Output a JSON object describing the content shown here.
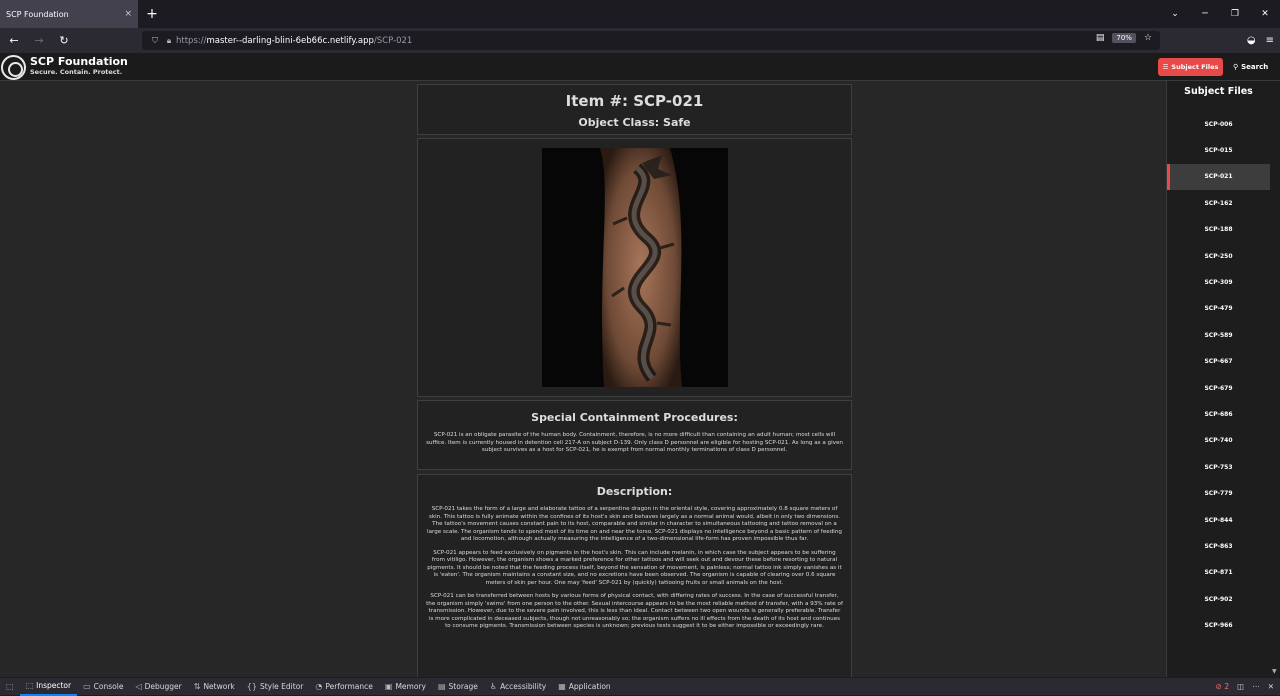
{
  "browser": {
    "tab_title": "SCP Foundation",
    "tab_close": "×",
    "new_tab": "+",
    "url_prefix": "https://",
    "url_host": "master--darling-blini-6eb66c.netlify.app",
    "url_path": "/SCP-021",
    "zoom": "70%",
    "window_controls": [
      "⌄",
      "─",
      "❐",
      "✕"
    ]
  },
  "site": {
    "logo_title": "SCP Foundation",
    "logo_subtitle": "Secure. Contain. Protect.",
    "subject_files_button": "Subject Files",
    "search_button": "Search"
  },
  "item": {
    "title": "Item #: SCP-021",
    "object_class": "Object Class: Safe",
    "containment_heading": "Special Containment Procedures:",
    "containment_text": "SCP-021 is an obligate parasite of the human body. Containment, therefore, is no more difficult than containing an adult human; most cells will suffice. Item is currently housed in detention cell 217-A on subject D-139. Only class D personnel are eligible for hosting SCP-021. As long as a given subject survives as a host for SCP-021, he is exempt from normal monthly terminations of class D personnel.",
    "description_heading": "Description:",
    "description_p1": "SCP-021 takes the form of a large and elaborate tattoo of a serpentine dragon in the oriental style, covering approximately 0.8 square meters of skin. This tattoo is fully animate within the confines of its host's skin and behaves largely as a normal animal would, albeit in only two dimensions. The tattoo's movement causes constant pain to its host, comparable and similar in character to simultaneous tattooing and tattoo removal on a large scale. The organism tends to spend most of its time on and near the torso. SCP-021 displays no intelligence beyond a basic pattern of feeding and locomotion, although actually measuring the intelligence of a two-dimensional life-form has proven impossible thus far.",
    "description_p2": "SCP-021 appears to feed exclusively on pigments in the host's skin. This can include melanin, in which case the subject appears to be suffering from vitiligo. However, the organism shows a marked preference for other tattoos and will seek out and devour these before resorting to natural pigments. It should be noted that the feeding process itself, beyond the sensation of movement, is painless; normal tattoo ink simply vanishes as it is 'eaten'. The organism maintains a constant size, and no excretions have been observed. The organism is capable of clearing over 0.6 square meters of skin per hour. One may 'feed' SCP-021 by (quickly) tattooing fruits or small animals on the host.",
    "description_p3": "SCP-021 can be transferred between hosts by various forms of physical contact, with differing rates of success. In the case of successful transfer, the organism simply 'swims' from one person to the other. Sexual intercourse appears to be the most reliable method of transfer, with a 93% rate of transmission. However, due to the severe pain involved, this is less than ideal. Contact between two open wounds is generally preferable. Transfer is more complicated in deceased subjects, though not unreasonably so; the organism suffers no ill effects from the death of its host and continues to consume pigments. Transmission between species is unknown; previous tests suggest it to be either impossible or exceedingly rare."
  },
  "sidebar": {
    "heading": "Subject Files",
    "items": [
      "SCP-006",
      "SCP-015",
      "SCP-021",
      "SCP-162",
      "SCP-188",
      "SCP-250",
      "SCP-309",
      "SCP-479",
      "SCP-589",
      "SCP-667",
      "SCP-679",
      "SCP-686",
      "SCP-740",
      "SCP-753",
      "SCP-779",
      "SCP-844",
      "SCP-863",
      "SCP-871",
      "SCP-902",
      "SCP-966"
    ],
    "active": "SCP-021"
  },
  "devtools": {
    "tabs": [
      "Inspector",
      "Console",
      "Debugger",
      "Network",
      "Style Editor",
      "Performance",
      "Memory",
      "Storage",
      "Accessibility",
      "Application"
    ],
    "active_tab": "Inspector",
    "error_count": "2"
  },
  "colors": {
    "accent_red": "#e84a4a",
    "devtools_blue": "#0a84ff"
  }
}
